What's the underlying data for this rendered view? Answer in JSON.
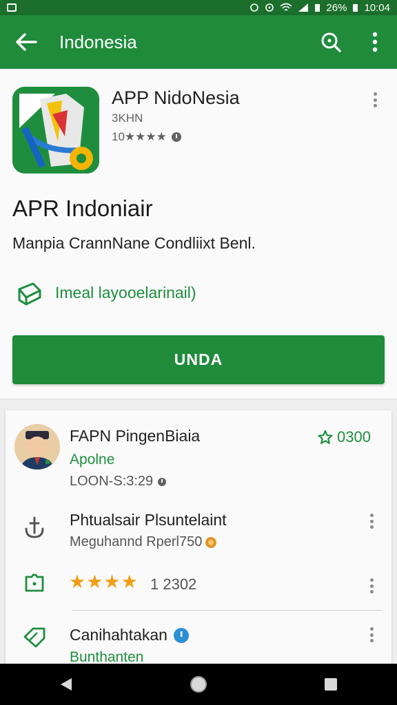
{
  "status_bar": {
    "battery": "26%",
    "time": "10:04"
  },
  "app_bar": {
    "title": "Indonesia"
  },
  "app": {
    "name": "APP NidoNesia",
    "developer": "3KHN",
    "rating_text": "10★★★★"
  },
  "headline": "APR Indoniair",
  "description": "Manpia CrannNane Condliixt Benl.",
  "feature": {
    "label": "Imeal layooelarinail)"
  },
  "install_button": {
    "label": "UNDA"
  },
  "list": {
    "items": [
      {
        "title": "FAPN PingenBiaia",
        "subtitle": "Apolne",
        "meta": "LOON-S:3:29",
        "badge": "0300"
      },
      {
        "title": "Phtualsair Plsuntelaint",
        "meta": "Meguhannd Rperl750"
      },
      {
        "rating_value": "1 2302",
        "stars": "★★★★"
      },
      {
        "title": "Canihahtakan",
        "subtitle": "Bunthanten"
      }
    ]
  },
  "colors": {
    "primary": "#1f8b3b",
    "primary_dark": "#1b6e2c",
    "accent_star": "#f29d16"
  }
}
